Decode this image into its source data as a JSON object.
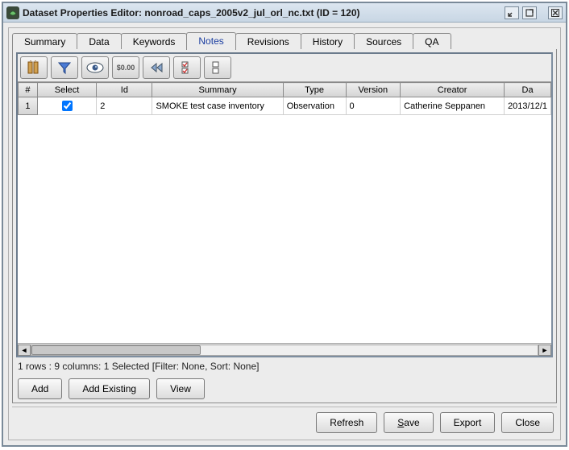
{
  "window": {
    "title": "Dataset Properties Editor: nonroad_caps_2005v2_jul_orl_nc.txt (ID = 120)"
  },
  "tabs": [
    "Summary",
    "Data",
    "Keywords",
    "Notes",
    "Revisions",
    "History",
    "Sources",
    "QA"
  ],
  "selected_tab_index": 3,
  "toolbar": {
    "icons": [
      "columns-icon",
      "filter-icon",
      "eye-icon",
      "format-icon",
      "first-icon",
      "checklist-icon",
      "stack-icon"
    ]
  },
  "table": {
    "headers": [
      "#",
      "Select",
      "Id",
      "Summary",
      "Type",
      "Version",
      "Creator",
      "Da"
    ],
    "rows": [
      {
        "row_num": "1",
        "select": true,
        "id": "2",
        "summary": "SMOKE test case inventory",
        "type": "Observation",
        "version": "0",
        "creator": "Catherine Seppanen",
        "date": "2013/12/1"
      }
    ]
  },
  "status": "1 rows : 9 columns: 1 Selected [Filter: None, Sort: None]",
  "action_buttons": {
    "add": "Add",
    "add_existing": "Add Existing",
    "view": "View"
  },
  "footer_buttons": {
    "refresh": "Refresh",
    "save_pre": "",
    "save_m": "S",
    "save_post": "ave",
    "export": "Export",
    "close": "Close"
  }
}
